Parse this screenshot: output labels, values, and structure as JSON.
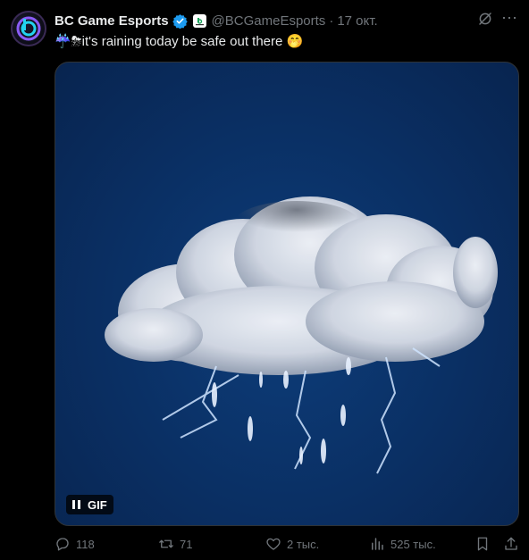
{
  "tweet": {
    "author_name": "BC Game Esports",
    "handle": "@BCGameEsports",
    "separator": "·",
    "date": "17 окт.",
    "text": "☔⛈it's raining today be safe out there 🤭",
    "media_badge": "GIF"
  },
  "actions": {
    "replies": "118",
    "retweets": "71",
    "likes": "2 тыс.",
    "views": "525 тыс."
  },
  "colors": {
    "verified": "#1d9bf0",
    "muted_text": "#71767b",
    "media_background": "#0a2f63"
  },
  "icons": {
    "avatar": "bc-game-logo",
    "verified": "verified-badge-icon",
    "affiliate": "affiliate-badge-icon",
    "grok": "grok-icon",
    "more": "more-icon",
    "reply": "reply-icon",
    "retweet": "retweet-icon",
    "like": "heart-icon",
    "views": "views-icon",
    "bookmark": "bookmark-icon",
    "share": "share-icon"
  }
}
